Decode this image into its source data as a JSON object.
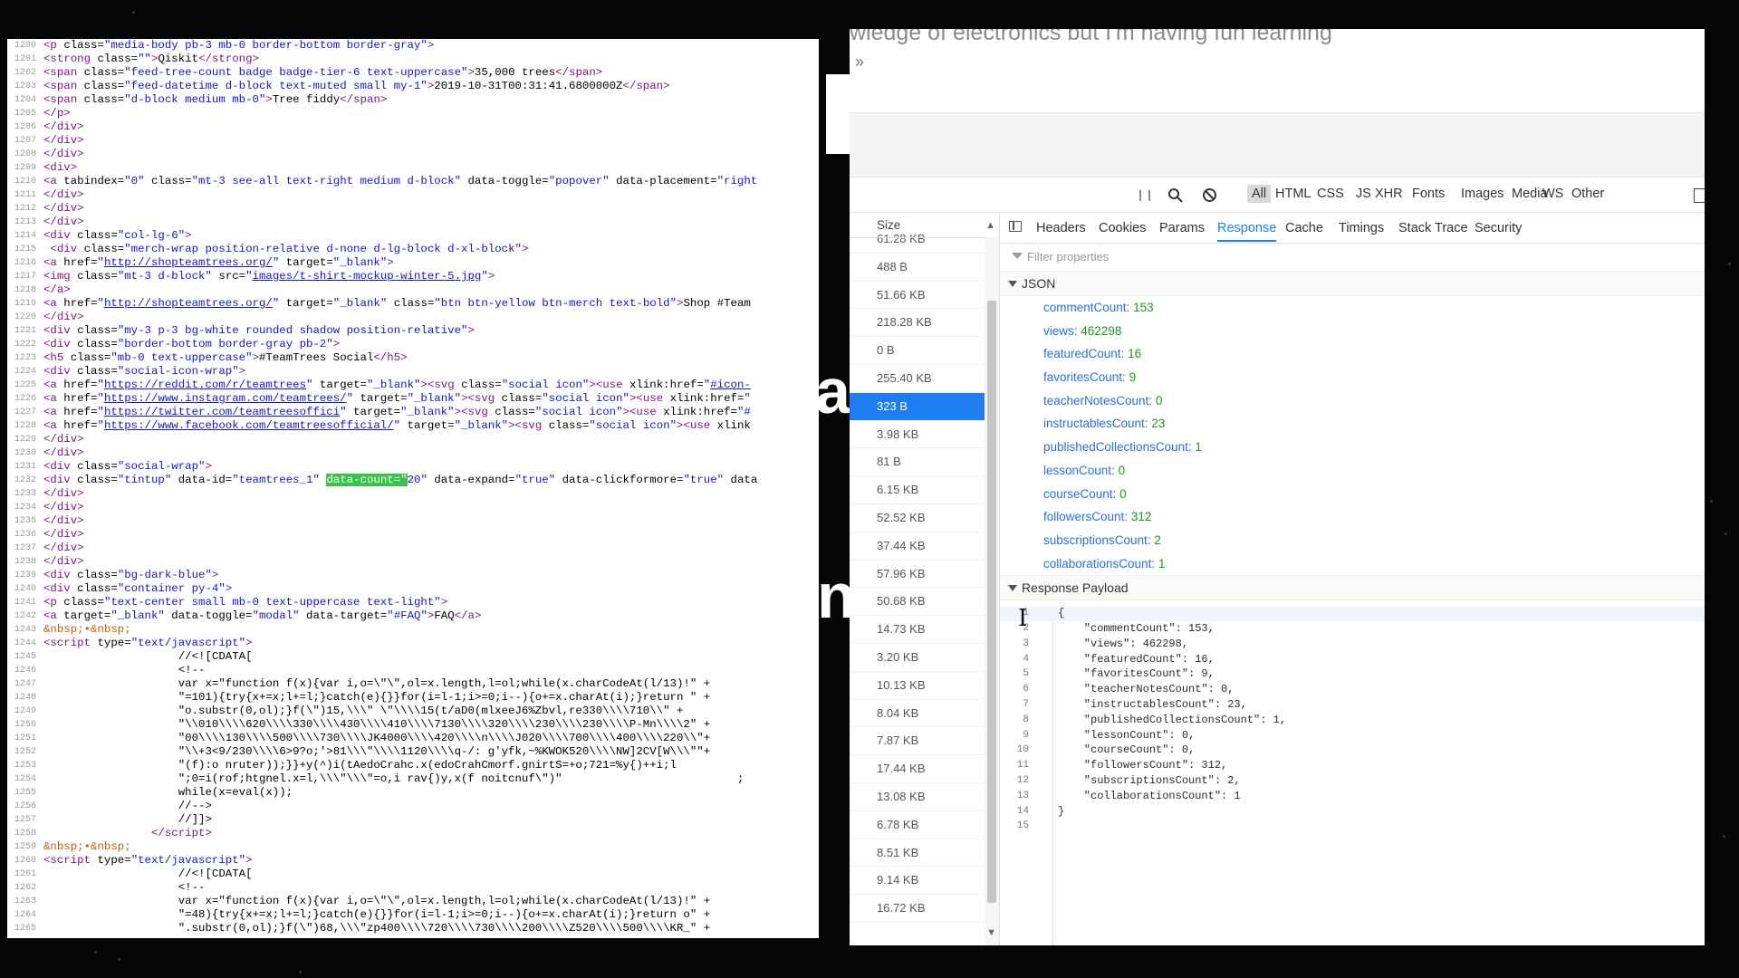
{
  "source_view": {
    "lines": [
      {
        "n": "1200",
        "html": "<span class='t-tag'>&lt;p</span> <span class='t-attr'>class=</span><span class='t-val'>\"media-body pb-3 mb-0 border-bottom border-gray\"</span><span class='t-tag'>&gt;</span>"
      },
      {
        "n": "1201",
        "html": "<span class='t-tag'>&lt;strong</span> class=<span class='t-val'>\"\"</span><span class='t-tag'>&gt;</span>Qiskit<span class='t-tag'>&lt;/strong&gt;</span>"
      },
      {
        "n": "1202",
        "html": "<span class='t-tag'>&lt;span</span> class=<span class='t-val'>\"feed-tree-count badge badge-tier-6 text-uppercase\"</span><span class='t-tag'>&gt;</span>35,000 trees<span class='t-tag'>&lt;/span&gt;</span>"
      },
      {
        "n": "1203",
        "html": "<span class='t-tag'>&lt;span</span> class=<span class='t-val'>\"feed-datetime d-block text-muted small my-1\"</span><span class='t-tag'>&gt;</span>2019-10-31T00:31:41.6800000Z<span class='t-tag'>&lt;/span&gt;</span>"
      },
      {
        "n": "1204",
        "html": "<span class='t-tag'>&lt;span</span> class=<span class='t-val'>\"d-block medium mb-0\"</span><span class='t-tag'>&gt;</span>Tree fiddy<span class='t-tag'>&lt;/span&gt;</span>"
      },
      {
        "n": "1205",
        "html": "<span class='t-tag'>&lt;/p&gt;</span>"
      },
      {
        "n": "1206",
        "html": "<span class='t-tag'>&lt;/div&gt;</span>"
      },
      {
        "n": "1207",
        "html": "<span class='t-tag'>&lt;/div&gt;</span>"
      },
      {
        "n": "1208",
        "html": "<span class='t-tag'>&lt;/div&gt;</span>"
      },
      {
        "n": "1209",
        "html": "<span class='t-tag'>&lt;div&gt;</span>"
      },
      {
        "n": "1210",
        "html": "<span class='t-tag'>&lt;a</span> tabindex=<span class='t-val'>\"0\"</span> class=<span class='t-val'>\"mt-3 see-all text-right medium d-block\"</span> data-toggle=<span class='t-val'>\"popover\"</span> data-placement=<span class='t-val'>\"right</span>"
      },
      {
        "n": "1211",
        "html": "<span class='t-tag'>&lt;/div&gt;</span>"
      },
      {
        "n": "1212",
        "html": "<span class='t-tag'>&lt;/div&gt;</span>"
      },
      {
        "n": "1213",
        "html": "<span class='t-tag'>&lt;/div&gt;</span>"
      },
      {
        "n": "1214",
        "html": "<span class='t-tag'>&lt;div</span> class=<span class='t-val'>\"col-lg-6\"</span><span class='t-tag'>&gt;</span>"
      },
      {
        "n": "1215",
        "html": " <span class='t-tag'>&lt;div</span> class=<span class='t-val'>\"merch-wrap position-relative d-none d-lg-block d-xl-block\"</span><span class='t-tag'>&gt;</span>"
      },
      {
        "n": "1216",
        "html": "<span class='t-tag'>&lt;a</span> href=<span class='t-val'>\"</span><span class='t-link'>http://shopteamtrees.org/</span><span class='t-val'>\"</span> target=<span class='t-val'>\"_blank\"</span><span class='t-tag'>&gt;</span>"
      },
      {
        "n": "1217",
        "html": "<span class='t-tag'>&lt;img</span> class=<span class='t-val'>\"mt-3 d-block\"</span> src=<span class='t-val'>\"</span><span class='t-link'>images/t-shirt-mockup-winter-5.jpg</span><span class='t-val'>\"</span><span class='t-tag'>&gt;</span>"
      },
      {
        "n": "1218",
        "html": "<span class='t-tag'>&lt;/a&gt;</span>"
      },
      {
        "n": "1219",
        "html": "<span class='t-tag'>&lt;a</span> href=<span class='t-val'>\"</span><span class='t-link'>http://shopteamtrees.org/</span><span class='t-val'>\"</span> target=<span class='t-val'>\"_blank\"</span> class=<span class='t-val'>\"btn btn-yellow btn-merch text-bold\"</span><span class='t-tag'>&gt;</span>Shop #Team"
      },
      {
        "n": "1220",
        "html": "<span class='t-tag'>&lt;/div&gt;</span>"
      },
      {
        "n": "1221",
        "html": "<span class='t-tag'>&lt;div</span> class=<span class='t-val'>\"my-3 p-3 bg-white rounded shadow position-relative\"</span><span class='t-tag'>&gt;</span>"
      },
      {
        "n": "1222",
        "html": "<span class='t-tag'>&lt;div</span> class=<span class='t-val'>\"border-bottom border-gray pb-2\"</span><span class='t-tag'>&gt;</span>"
      },
      {
        "n": "1223",
        "html": "<span class='t-tag'>&lt;h5</span> class=<span class='t-val'>\"mb-0 text-uppercase\"</span><span class='t-tag'>&gt;</span>#TeamTrees Social<span class='t-tag'>&lt;/h5&gt;</span>"
      },
      {
        "n": "1224",
        "html": "<span class='t-tag'>&lt;div</span> class=<span class='t-val'>\"social-icon-wrap\"</span><span class='t-tag'>&gt;</span>"
      },
      {
        "n": "1225",
        "html": "<span class='t-tag'>&lt;a</span> href=<span class='t-val'>\"</span><span class='t-link'>https://reddit.com/r/teamtrees</span><span class='t-val'>\"</span> target=<span class='t-val'>\"_blank\"</span><span class='t-tag'>&gt;&lt;svg</span> class=<span class='t-val'>\"social icon\"</span><span class='t-tag'>&gt;&lt;use</span> xlink:href=<span class='t-val'>\"</span><span class='t-link'>#icon-</span>"
      },
      {
        "n": "1226",
        "html": "<span class='t-tag'>&lt;a</span> href=<span class='t-val'>\"</span><span class='t-link'>https://www.instagram.com/teamtrees/</span><span class='t-val'>\"</span> target=<span class='t-val'>\"_blank\"</span><span class='t-tag'>&gt;&lt;svg</span> class=<span class='t-val'>\"social icon\"</span><span class='t-tag'>&gt;&lt;use</span> xlink:href=<span class='t-val'>\"</span>"
      },
      {
        "n": "1227",
        "html": "<span class='t-tag'>&lt;a</span> href=<span class='t-val'>\"</span><span class='t-link'>https://twitter.com/teamtreesoffici</span><span class='t-val'>\"</span> target=<span class='t-val'>\"_blank\"</span><span class='t-tag'>&gt;&lt;svg</span> class=<span class='t-val'>\"social icon\"</span><span class='t-tag'>&gt;&lt;use</span> xlink:href=<span class='t-val'>\"#</span>"
      },
      {
        "n": "1228",
        "html": "<span class='t-tag'>&lt;a</span> href=<span class='t-val'>\"</span><span class='t-link'>https://www.facebook.com/teamtreesofficial/</span><span class='t-val'>\"</span> target=<span class='t-val'>\"_blank\"</span><span class='t-tag'>&gt;&lt;svg</span> class=<span class='t-val'>\"social icon\"</span><span class='t-tag'>&gt;&lt;use</span> xlink"
      },
      {
        "n": "1229",
        "html": "<span class='t-tag'>&lt;/div&gt;</span>"
      },
      {
        "n": "1230",
        "html": "<span class='t-tag'>&lt;/div&gt;</span>"
      },
      {
        "n": "1231",
        "html": "<span class='t-tag'>&lt;div</span> class=<span class='t-val'>\"social-wrap\"</span><span class='t-tag'>&gt;</span>"
      },
      {
        "n": "1232",
        "html": "<span class='t-tag'>&lt;div</span> class=<span class='t-val'>\"tintup\"</span> data-id=<span class='t-val'>\"teamtrees_1\"</span> <span class='t-hl'>data-count=\"</span><span class='t-val'>20\"</span> data-expand=<span class='t-val'>\"true\"</span> data-clickformore=<span class='t-val'>\"true\"</span> data"
      },
      {
        "n": "1233",
        "html": "<span class='t-tag'>&lt;/div&gt;</span>"
      },
      {
        "n": "1234",
        "html": "<span class='t-tag'>&lt;/div&gt;</span>"
      },
      {
        "n": "1235",
        "html": "<span class='t-tag'>&lt;/div&gt;</span>"
      },
      {
        "n": "1236",
        "html": "<span class='t-tag'>&lt;/div&gt;</span>"
      },
      {
        "n": "1237",
        "html": "<span class='t-tag'>&lt;/div&gt;</span>"
      },
      {
        "n": "1238",
        "html": "<span class='t-tag'>&lt;/div&gt;</span>"
      },
      {
        "n": "1239",
        "html": "<span class='t-tag'>&lt;div</span> class=<span class='t-val'>\"bg-dark-blue\"</span><span class='t-tag'>&gt;</span>"
      },
      {
        "n": "1240",
        "html": "<span class='t-tag'>&lt;div</span> class=<span class='t-val'>\"container py-4\"</span><span class='t-tag'>&gt;</span>"
      },
      {
        "n": "1241",
        "html": "<span class='t-tag'>&lt;p</span> class=<span class='t-val'>\"text-center small mb-0 text-uppercase text-light\"</span><span class='t-tag'>&gt;</span>"
      },
      {
        "n": "1242",
        "html": "<span class='t-tag'>&lt;a</span> target=<span class='t-val'>\"_blank\"</span> data-toggle=<span class='t-val'>\"modal\"</span> data-target=<span class='t-val'>\"#FAQ\"</span><span class='t-tag'>&gt;</span>FAQ<span class='t-tag'>&lt;/a&gt;</span>"
      },
      {
        "n": "1243",
        "html": "<span class='t-ent'>&amp;nbsp;•&amp;nbsp;</span>"
      },
      {
        "n": "1244",
        "html": "<span class='t-tag'>&lt;script</span> type=<span class='t-val'>\"text/javascript\"</span><span class='t-tag'>&gt;</span>"
      },
      {
        "n": "1245",
        "html": "                    //&lt;![CDATA["
      },
      {
        "n": "1246",
        "html": "                    &lt;!--"
      },
      {
        "n": "1247",
        "html": "                    var x=\"function f(x){var i,o=\\\"\\\",ol=x.length,l=ol;while(x.charCodeAt(l/13)!\" +"
      },
      {
        "n": "1248",
        "html": "                    \"=101){try{x+=x;l+=l;}catch(e){}}for(i=l-1;i>=0;i--){o+=x.charAt(i);}return \" +"
      },
      {
        "n": "1249",
        "html": "                    \"o.substr(0,ol);}f(\\\")15,\\\\\\\" \\\"\\\\\\\\15(t/aD0(mlxeeJ6%Zbvl,re330\\\\\\\\710\\\\\" +"
      },
      {
        "n": "1250",
        "html": "                    \"\\\\010\\\\\\\\620\\\\\\\\330\\\\\\\\430\\\\\\\\410\\\\\\\\7130\\\\\\\\320\\\\\\\\230\\\\\\\\230\\\\\\\\P-Mn\\\\\\\\2\" +"
      },
      {
        "n": "1251",
        "html": "                    \"00\\\\\\\\130\\\\\\\\500\\\\\\\\730\\\\\\\\JK4000\\\\\\\\420\\\\\\\\n\\\\\\\\J020\\\\\\\\700\\\\\\\\400\\\\\\\\220\\\\\"+"
      },
      {
        "n": "1252",
        "html": "                    \"\\\\+3<9/230\\\\\\\\6>9?o;'>81\\\\\\\"\\\\\\\\1120\\\\\\\\q-/: g'yfk,~%KWOK520\\\\\\\\NW]2CV[W\\\\\\\"\"+"
      },
      {
        "n": "1253",
        "html": "                    \"(f):o nruter));}}+y(^)i(tAedoCrahc.x(edoCrahCmorf.gnirtS=+o;721=%y{)++i;l<i\" +"
      },
      {
        "n": "1254",
        "html": "                    \";0=i(rof;htgnel.x=l,\\\\\\\"\\\\\\\"=o,i rav{)y,x(f noitcnuf\\\")\"                          ;"
      },
      {
        "n": "1255",
        "html": "                    while(x=eval(x));"
      },
      {
        "n": "1256",
        "html": "                    //--&gt;"
      },
      {
        "n": "1257",
        "html": "                    //]]&gt;"
      },
      {
        "n": "1258",
        "html": "                <span class='t-tag'>&lt;/script&gt;</span>"
      },
      {
        "n": "1259",
        "html": "<span class='t-ent'>&amp;nbsp;•&amp;nbsp;</span>"
      },
      {
        "n": "1260",
        "html": "<span class='t-tag'>&lt;script</span> type=<span class='t-val'>\"text/javascript\"</span><span class='t-tag'>&gt;</span>"
      },
      {
        "n": "1261",
        "html": "                    //&lt;![CDATA["
      },
      {
        "n": "1262",
        "html": "                    &lt;!--"
      },
      {
        "n": "1263",
        "html": "                    var x=\"function f(x){var i,o=\\\"\\\",ol=x.length,l=ol;while(x.charCodeAt(l/13)!\" +"
      },
      {
        "n": "1264",
        "html": "                    \"=48){try{x+=x;l+=l;}catch(e){}}for(i=l-1;i>=0;i--){o+=x.charAt(i);}return o\" +"
      },
      {
        "n": "1265",
        "html": "                    \".substr(0,ol);}f(\\\")68,\\\\\\\"zp400\\\\\\\\720\\\\\\\\730\\\\\\\\200\\\\\\\\Z520\\\\\\\\500\\\\\\\\KR_\" +"
      }
    ]
  },
  "page_strip": {
    "heading": "wledge of electronics but I'm having fun learning",
    "chevron": "»"
  },
  "toolbar": {
    "pause": "❙❙",
    "filters": [
      "All",
      "HTML",
      "CSS",
      "JS",
      "XHR",
      "Fonts",
      "Images",
      "Media",
      "WS",
      "Other"
    ],
    "active_filter": "All"
  },
  "size_column": {
    "header": "Size",
    "rows": [
      "61.28 KB",
      "488 B",
      "51.66 KB",
      "218.28 KB",
      "0 B",
      "255.40 KB",
      "323 B",
      "3.98 KB",
      "81 B",
      "6.15 KB",
      "52.52 KB",
      "37.44 KB",
      "57.96 KB",
      "50.68 KB",
      "14.73 KB",
      "3.20 KB",
      "10.13 KB",
      "8.04 KB",
      "7.87 KB",
      "17.44 KB",
      "13.08 KB",
      "6.78 KB",
      "8.51 KB",
      "9.14 KB",
      "16.72 KB"
    ],
    "selected_index": 6
  },
  "detail_tabs": {
    "tabs": [
      "Headers",
      "Cookies",
      "Params",
      "Response",
      "Cache",
      "Timings",
      "Stack Trace",
      "Security"
    ],
    "active": "Response"
  },
  "filter_properties": {
    "placeholder": "Filter properties"
  },
  "json_section": {
    "title": "JSON",
    "entries": [
      {
        "key": "commentCount",
        "value": "153"
      },
      {
        "key": "views",
        "value": "462298"
      },
      {
        "key": "featuredCount",
        "value": "16"
      },
      {
        "key": "favoritesCount",
        "value": "9"
      },
      {
        "key": "teacherNotesCount",
        "value": "0"
      },
      {
        "key": "instructablesCount",
        "value": "23"
      },
      {
        "key": "publishedCollectionsCount",
        "value": "1"
      },
      {
        "key": "lessonCount",
        "value": "0"
      },
      {
        "key": "courseCount",
        "value": "0"
      },
      {
        "key": "followersCount",
        "value": "312"
      },
      {
        "key": "subscriptionsCount",
        "value": "2"
      },
      {
        "key": "collaborationsCount",
        "value": "1"
      }
    ]
  },
  "payload_section": {
    "title": "Response Payload",
    "lines": [
      {
        "n": "1",
        "text": "{"
      },
      {
        "n": "2",
        "text": "    \"commentCount\": 153,"
      },
      {
        "n": "3",
        "text": "    \"views\": 462298,"
      },
      {
        "n": "4",
        "text": "    \"featuredCount\": 16,"
      },
      {
        "n": "5",
        "text": "    \"favoritesCount\": 9,"
      },
      {
        "n": "6",
        "text": "    \"teacherNotesCount\": 0,"
      },
      {
        "n": "7",
        "text": "    \"instructablesCount\": 23,"
      },
      {
        "n": "8",
        "text": "    \"publishedCollectionsCount\": 1,"
      },
      {
        "n": "9",
        "text": "    \"lessonCount\": 0,"
      },
      {
        "n": "10",
        "text": "    \"courseCount\": 0,"
      },
      {
        "n": "11",
        "text": "    \"followersCount\": 312,"
      },
      {
        "n": "12",
        "text": "    \"subscriptionsCount\": 2,"
      },
      {
        "n": "13",
        "text": "    \"collaborationsCount\": 1"
      },
      {
        "n": "14",
        "text": "}"
      },
      {
        "n": "15",
        "text": ""
      }
    ]
  },
  "colors": {
    "selected_row": "#1e7ef1",
    "json_key": "#2a6fd6",
    "json_value": "#1a9a1a",
    "highlight": "#38c44a"
  }
}
